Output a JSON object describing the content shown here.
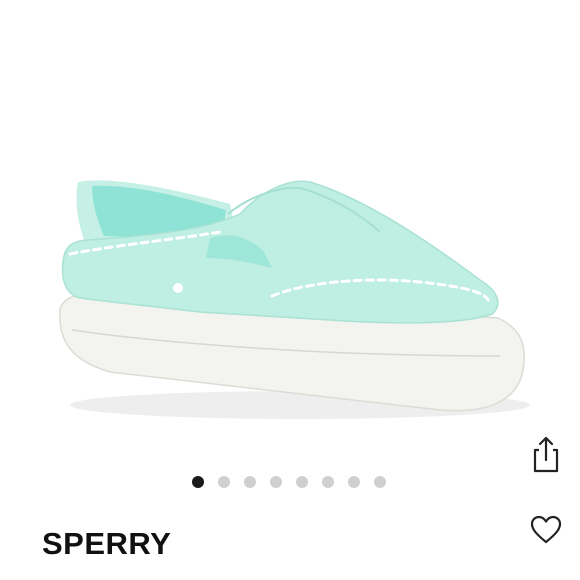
{
  "product": {
    "brand": "SPERRY",
    "image_icon": "mint-slip-on-canvas-shoe",
    "colors": {
      "upper": "#bfeee2",
      "lining": "#8fe3d6",
      "sole": "#f3f3ef",
      "stitch": "#ffffff"
    }
  },
  "gallery": {
    "total_images": 8,
    "active_index": 0
  },
  "actions": {
    "share_icon": "share-icon",
    "like_icon": "heart-icon"
  }
}
